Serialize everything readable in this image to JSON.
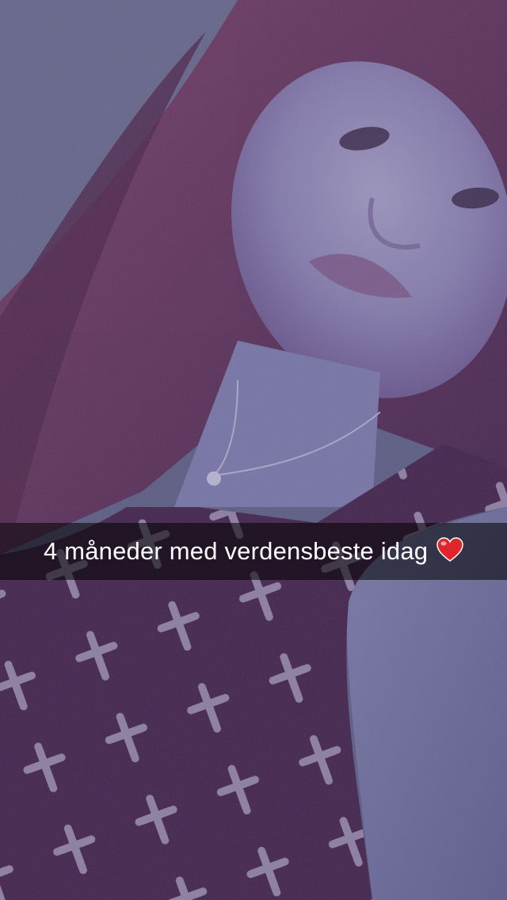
{
  "snap": {
    "caption": "4 måneder med verdensbeste idag",
    "caption_emoji": "heart-icon",
    "heart_color": "#e0262b"
  }
}
